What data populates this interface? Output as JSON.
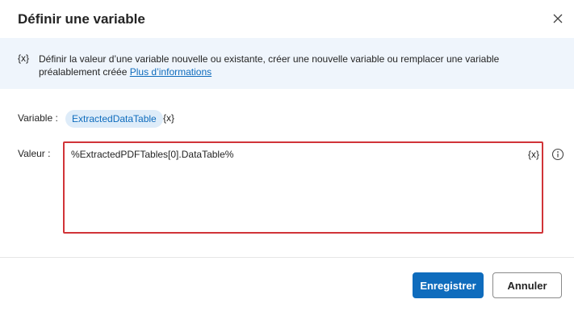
{
  "dialog": {
    "title": "Définir une variable",
    "close_icon": "close-icon"
  },
  "info": {
    "icon_text": "{x}",
    "text_line1": "Définir la valeur d’une variable nouvelle ou existante, créer une nouvelle variable ou remplacer une variable",
    "text_line2": "préalablement créée",
    "link_text": "Plus d’informations"
  },
  "form": {
    "variable_label": "Variable :",
    "variable_name": "ExtractedDataTable",
    "variable_picker": "{x}",
    "value_label": "Valeur :",
    "value_text": "%ExtractedPDFTables[0].DataTable%",
    "value_picker": "{x}",
    "info_icon": "info-icon"
  },
  "buttons": {
    "save_label": "Enregistrer",
    "cancel_label": "Annuler"
  },
  "colors": {
    "accent": "#0f6cbd",
    "info_band": "#eff5fc",
    "chip_bg": "#deecf9",
    "highlight_border": "#d13438"
  }
}
